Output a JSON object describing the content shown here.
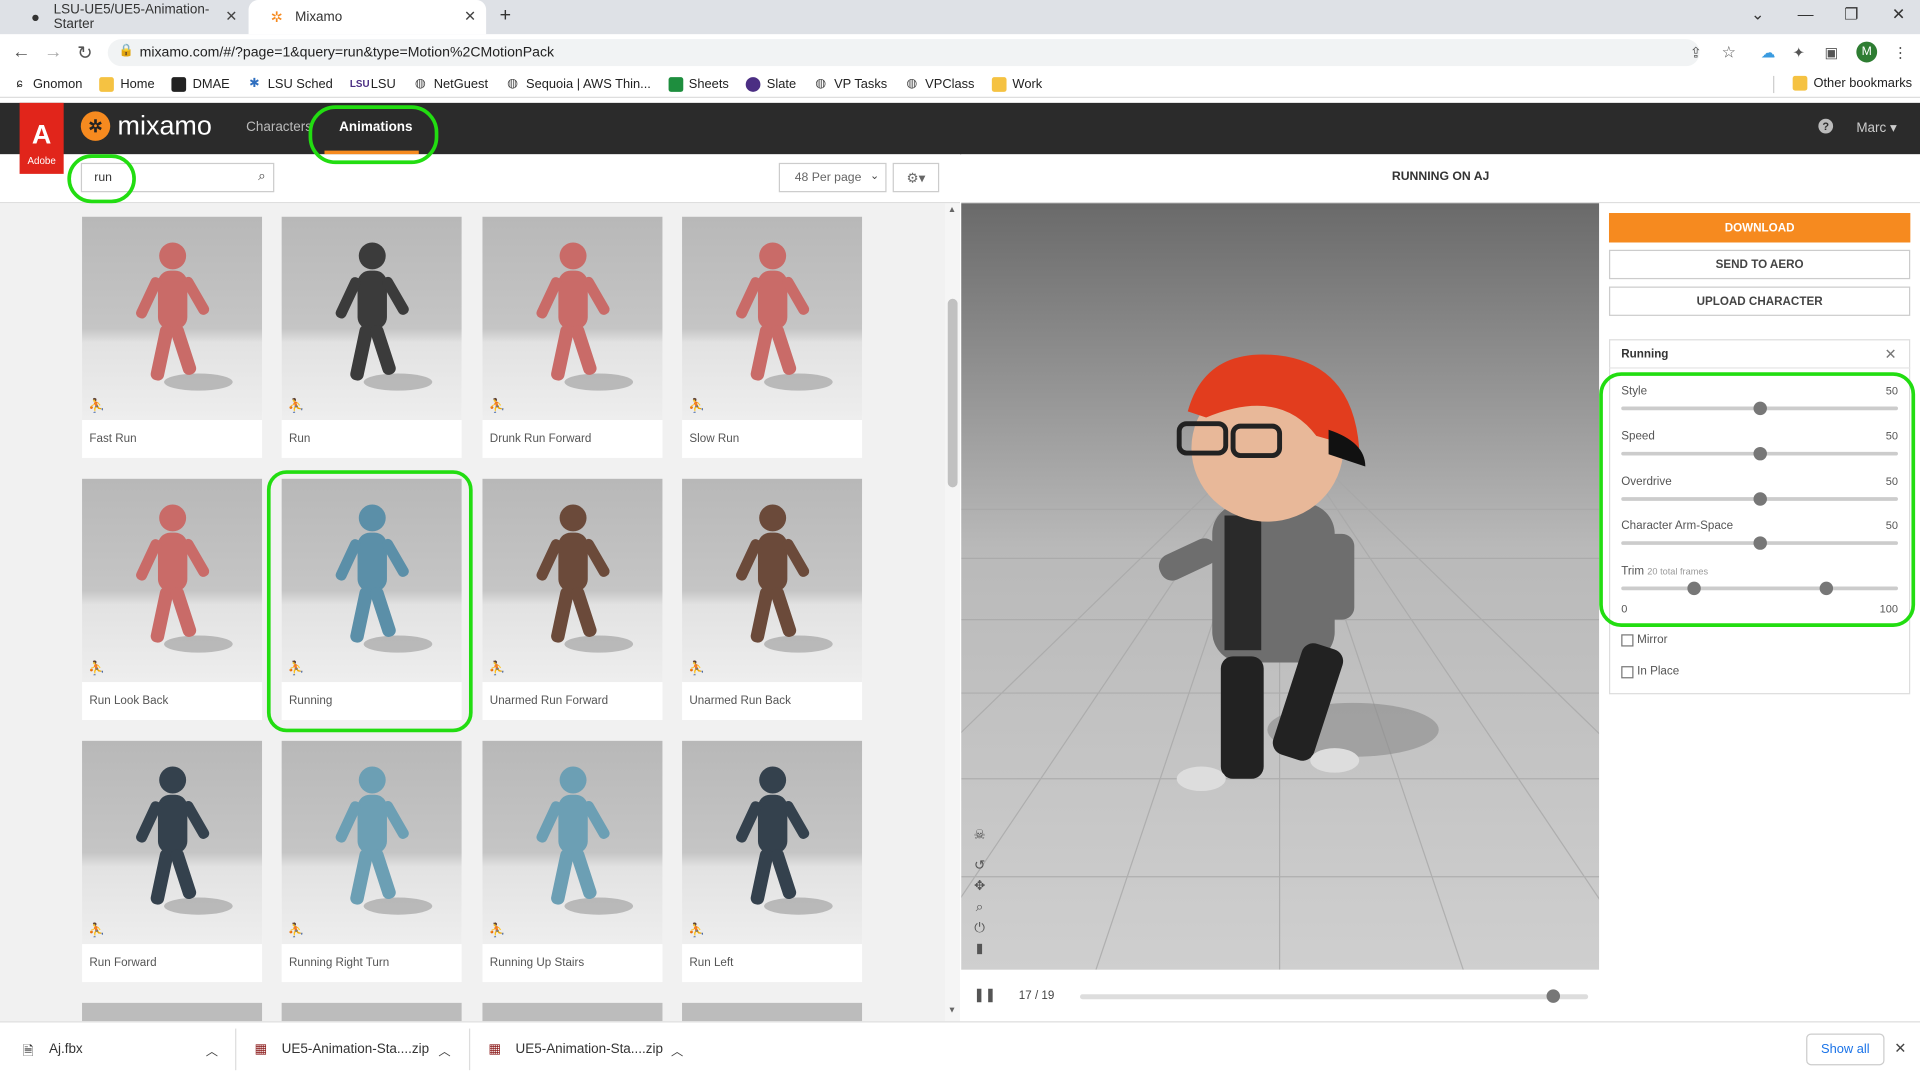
{
  "browser": {
    "tabs": [
      {
        "title": "LSU-UE5/UE5-Animation-Starter"
      },
      {
        "title": "Mixamo"
      }
    ],
    "new_tab": "+",
    "url": "mixamo.com/#/?page=1&query=run&type=Motion%2CMotionPack",
    "bookmarks": [
      "Gnomon",
      "Home",
      "DMAE",
      "LSU Sched",
      "LSU",
      "NetGuest",
      "Sequoia | AWS Thin...",
      "Sheets",
      "Slate",
      "VP Tasks",
      "VPClass",
      "Work"
    ],
    "other_bookmarks": "Other bookmarks",
    "profile_initial": "M"
  },
  "header": {
    "adobe": "Adobe",
    "logo": "mixamo",
    "nav": {
      "characters": "Characters",
      "animations": "Animations"
    },
    "user": "Marc"
  },
  "toolbar": {
    "search_value": "run",
    "per_page": "48 Per page"
  },
  "animations": [
    {
      "name": "Fast Run"
    },
    {
      "name": "Run"
    },
    {
      "name": "Drunk Run Forward"
    },
    {
      "name": "Slow Run"
    },
    {
      "name": "Run Look Back"
    },
    {
      "name": "Running"
    },
    {
      "name": "Unarmed Run Forward"
    },
    {
      "name": "Unarmed Run Back"
    },
    {
      "name": "Run Forward"
    },
    {
      "name": "Running Right Turn"
    },
    {
      "name": "Running Up Stairs"
    },
    {
      "name": "Run Left"
    }
  ],
  "viewer": {
    "title": "RUNNING ON AJ",
    "frames": "17 / 19",
    "progress": 0.93
  },
  "actions": {
    "download": "DOWNLOAD",
    "send": "SEND TO AERO",
    "upload": "UPLOAD CHARACTER"
  },
  "settings": {
    "name": "Running",
    "sliders": [
      {
        "label": "Style",
        "value": "50"
      },
      {
        "label": "Speed",
        "value": "50"
      },
      {
        "label": "Overdrive",
        "value": "50"
      },
      {
        "label": "Character Arm-Space",
        "value": "50"
      }
    ],
    "trim": {
      "label": "Trim",
      "note": "20 total frames",
      "min": "0",
      "max": "100"
    },
    "mirror": "Mirror",
    "in_place": "In Place"
  },
  "downloads": {
    "items": [
      "Aj.fbx",
      "UE5-Animation-Sta....zip",
      "UE5-Animation-Sta....zip"
    ],
    "show_all": "Show all"
  },
  "colors": {
    "accent": "#f68a1f",
    "header": "#2b2b2b",
    "highlight": "#22dd11",
    "adobe": "#e1251b"
  }
}
